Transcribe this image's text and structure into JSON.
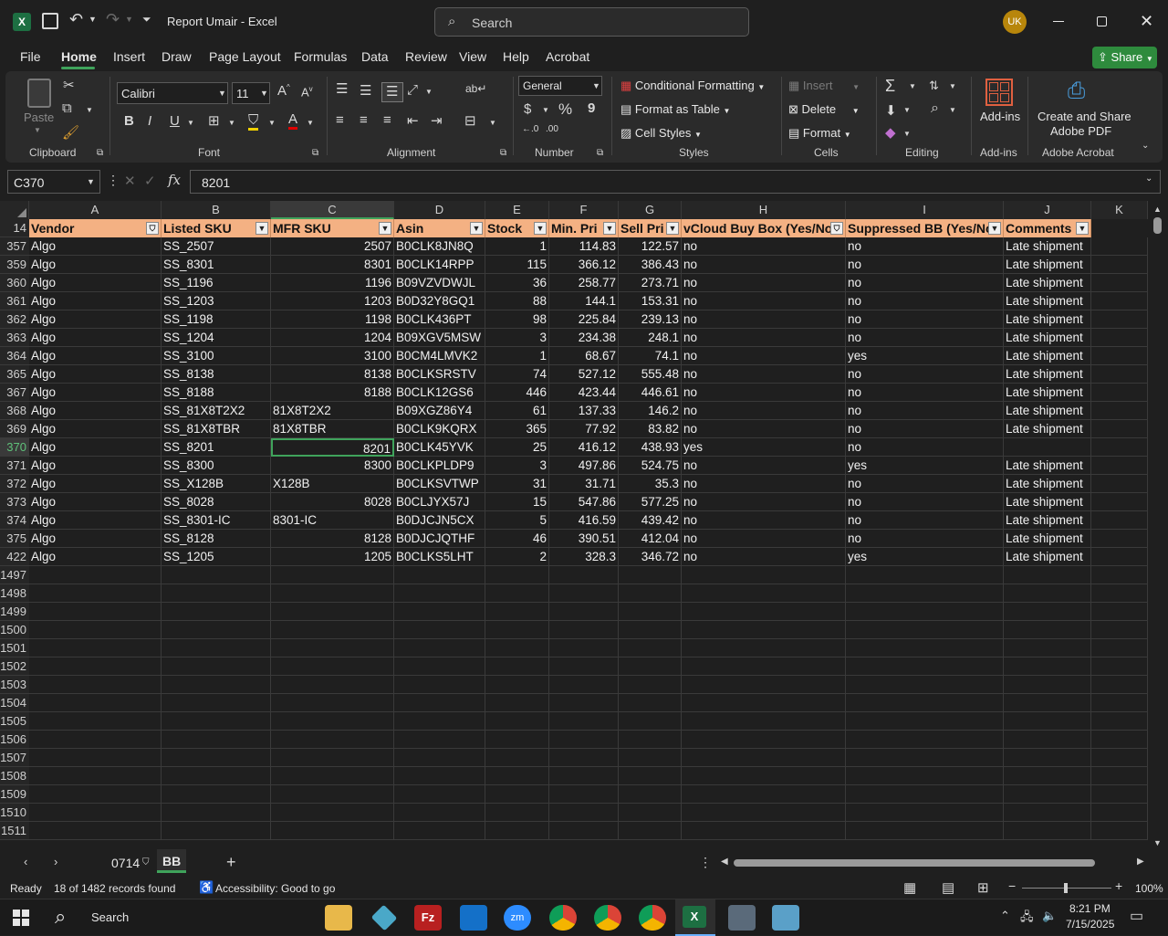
{
  "app": {
    "title": "Report Umair  -  Excel",
    "search_placeholder": "Search",
    "user_initials": "UK"
  },
  "menu_tabs": [
    "File",
    "Home",
    "Insert",
    "Draw",
    "Page Layout",
    "Formulas",
    "Data",
    "Review",
    "View",
    "Help",
    "Acrobat"
  ],
  "share_label": "Share",
  "ribbon": {
    "paste": "Paste",
    "clipboard": "Clipboard",
    "font_name": "Calibri",
    "font_size": "11",
    "font": "Font",
    "alignment": "Alignment",
    "number_format": "General",
    "number": "Number",
    "conditional_formatting": "Conditional Formatting",
    "format_as_table": "Format as Table",
    "cell_styles": "Cell Styles",
    "styles": "Styles",
    "insert": "Insert",
    "delete": "Delete",
    "format": "Format",
    "cells": "Cells",
    "editing": "Editing",
    "addins_btn": "Add-ins",
    "addins": "Add-ins",
    "create_share_1": "Create and Share",
    "create_share_2": "Adobe PDF",
    "adobe_acrobat": "Adobe Acrobat"
  },
  "formula_bar": {
    "name_box": "C370",
    "fx": "fx",
    "value": "8201"
  },
  "columns": [
    "A",
    "B",
    "C",
    "D",
    "E",
    "F",
    "G",
    "H",
    "I",
    "J",
    "K"
  ],
  "header_row": {
    "row_num": "14",
    "cells": [
      "Vendor",
      "Listed SKU",
      "MFR SKU",
      "Asin",
      "Stock",
      "Min. Pri",
      "Sell Pri",
      "vCloud Buy Box (Yes/No",
      "Suppressed BB (Yes/No",
      "Comments"
    ]
  },
  "rows": [
    {
      "n": "357",
      "c": [
        "Algo",
        "SS_2507",
        "2507",
        "B0CLK8JN8Q",
        "1",
        "114.83",
        "122.57",
        "no",
        "no",
        "Late shipment"
      ]
    },
    {
      "n": "359",
      "c": [
        "Algo",
        "SS_8301",
        "8301",
        "B0CLK14RPP",
        "115",
        "366.12",
        "386.43",
        "no",
        "no",
        "Late shipment"
      ]
    },
    {
      "n": "360",
      "c": [
        "Algo",
        "SS_1196",
        "1196",
        "B09VZVDWJL",
        "36",
        "258.77",
        "273.71",
        "no",
        "no",
        "Late shipment"
      ]
    },
    {
      "n": "361",
      "c": [
        "Algo",
        "SS_1203",
        "1203",
        "B0D32Y8GQ1",
        "88",
        "144.1",
        "153.31",
        "no",
        "no",
        "Late shipment"
      ]
    },
    {
      "n": "362",
      "c": [
        "Algo",
        "SS_1198",
        "1198",
        "B0CLK436PT",
        "98",
        "225.84",
        "239.13",
        "no",
        "no",
        "Late shipment"
      ]
    },
    {
      "n": "363",
      "c": [
        "Algo",
        "SS_1204",
        "1204",
        "B09XGV5MSW",
        "3",
        "234.38",
        "248.1",
        "no",
        "no",
        "Late shipment"
      ]
    },
    {
      "n": "364",
      "c": [
        "Algo",
        "SS_3100",
        "3100",
        "B0CM4LMVK2",
        "1",
        "68.67",
        "74.1",
        "no",
        "yes",
        "Late shipment"
      ]
    },
    {
      "n": "365",
      "c": [
        "Algo",
        "SS_8138",
        "8138",
        "B0CLKSRSTV",
        "74",
        "527.12",
        "555.48",
        "no",
        "no",
        "Late shipment"
      ]
    },
    {
      "n": "367",
      "c": [
        "Algo",
        "SS_8188",
        "8188",
        "B0CLK12GS6",
        "446",
        "423.44",
        "446.61",
        "no",
        "no",
        "Late shipment"
      ]
    },
    {
      "n": "368",
      "c": [
        "Algo",
        "SS_81X8T2X2",
        "81X8T2X2",
        "B09XGZ86Y4",
        "61",
        "137.33",
        "146.2",
        "no",
        "no",
        "Late shipment"
      ]
    },
    {
      "n": "369",
      "c": [
        "Algo",
        "SS_81X8TBR",
        "81X8TBR",
        "B0CLK9KQRX",
        "365",
        "77.92",
        "83.82",
        "no",
        "no",
        "Late shipment"
      ]
    },
    {
      "n": "370",
      "c": [
        "Algo",
        "SS_8201",
        "8201",
        "B0CLK45YVK",
        "25",
        "416.12",
        "438.93",
        "yes",
        "no",
        ""
      ]
    },
    {
      "n": "371",
      "c": [
        "Algo",
        "SS_8300",
        "8300",
        "B0CLKPLDP9",
        "3",
        "497.86",
        "524.75",
        "no",
        "yes",
        "Late shipment"
      ]
    },
    {
      "n": "372",
      "c": [
        "Algo",
        "SS_X128B",
        "X128B",
        "B0CLKSVTWP",
        "31",
        "31.71",
        "35.3",
        "no",
        "no",
        "Late shipment"
      ]
    },
    {
      "n": "373",
      "c": [
        "Algo",
        "SS_8028",
        "8028",
        "B0CLJYX57J",
        "15",
        "547.86",
        "577.25",
        "no",
        "no",
        "Late shipment"
      ]
    },
    {
      "n": "374",
      "c": [
        "Algo",
        "SS_8301-IC",
        "8301-IC",
        "B0DJCJN5CX",
        "5",
        "416.59",
        "439.42",
        "no",
        "no",
        "Late shipment"
      ]
    },
    {
      "n": "375",
      "c": [
        "Algo",
        "SS_8128",
        "8128",
        "B0DJCJQTHF",
        "46",
        "390.51",
        "412.04",
        "no",
        "no",
        "Late shipment"
      ]
    },
    {
      "n": "422",
      "c": [
        "Algo",
        "SS_1205",
        "1205",
        "B0CLKS5LHT",
        "2",
        "328.3",
        "346.72",
        "no",
        "yes",
        "Late shipment"
      ]
    }
  ],
  "empty_rows": [
    "1497",
    "1498",
    "1499",
    "1500",
    "1501",
    "1502",
    "1503",
    "1504",
    "1505",
    "1506",
    "1507",
    "1508",
    "1509",
    "1510",
    "1511"
  ],
  "sheet_tabs": [
    "0714",
    "BB"
  ],
  "active_sheet": "BB",
  "status": {
    "ready": "Ready",
    "records": "18 of 1482 records found",
    "accessibility": "Accessibility: Good to go",
    "zoom": "100%"
  },
  "taskbar": {
    "search": "Search",
    "time": "8:21 PM",
    "date": "7/15/2025"
  },
  "colors": {
    "header_fill": "#f4b183",
    "excel_green": "#1d6f42",
    "share_green": "#2e8b3d"
  }
}
